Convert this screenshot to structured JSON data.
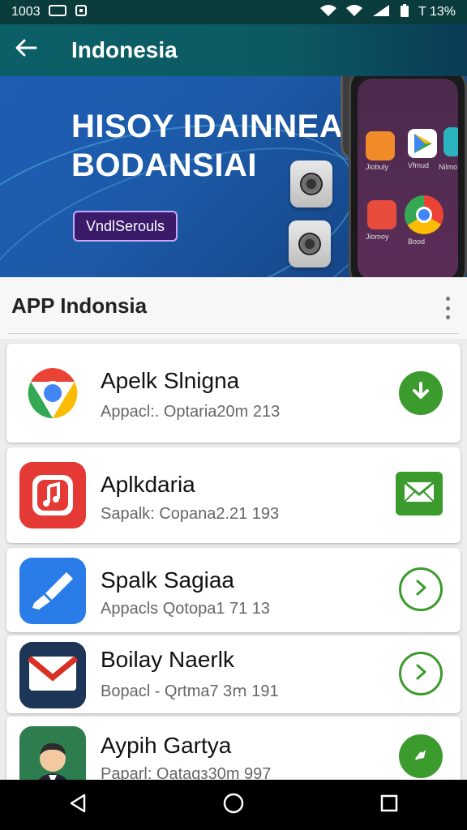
{
  "status_bar": {
    "time": "1003",
    "battery_text": "T 13%"
  },
  "app_bar": {
    "title": "Indonesia"
  },
  "banner": {
    "headline_line1": "HISOY IDAINNEA",
    "headline_line2": "BODANSIAI",
    "button_label": "VndlSerouls",
    "phone_tile_labels": [
      "Jiobuly",
      "Vfmud",
      "Jiomoy",
      "Bood",
      "Nilmo"
    ]
  },
  "section": {
    "title": "APP Indonsia"
  },
  "apps": [
    {
      "name": "Apelk Slnigna",
      "subtitle": "Appacl:. Optaria20m 213",
      "icon": "chrome-icon",
      "action": "download-icon",
      "action_color": "#3b9b2d"
    },
    {
      "name": "Aplkdaria",
      "subtitle": "Sapalk: Copana2.21 193",
      "icon": "music-icon",
      "action": "mail-icon",
      "action_color": "#3b9b2d"
    },
    {
      "name": "Spalk Sagiaa",
      "subtitle": "Appacls Qotopa1 71 13",
      "icon": "brush-icon",
      "action": "chevron-right-icon",
      "action_color": "#3b9b2d"
    },
    {
      "name": "Boilay Naerlk",
      "subtitle": "Bopacl - Qrtma7 3ꭑ 191",
      "icon": "gmail-icon",
      "action": "chevron-right-icon",
      "action_color": "#3b9b2d"
    },
    {
      "name": "Aypih Gartya",
      "subtitle": "Paparl: Oatagз30m 997",
      "icon": "avatar-icon",
      "action": "play-icon",
      "action_color": "#3b9b2d"
    }
  ]
}
